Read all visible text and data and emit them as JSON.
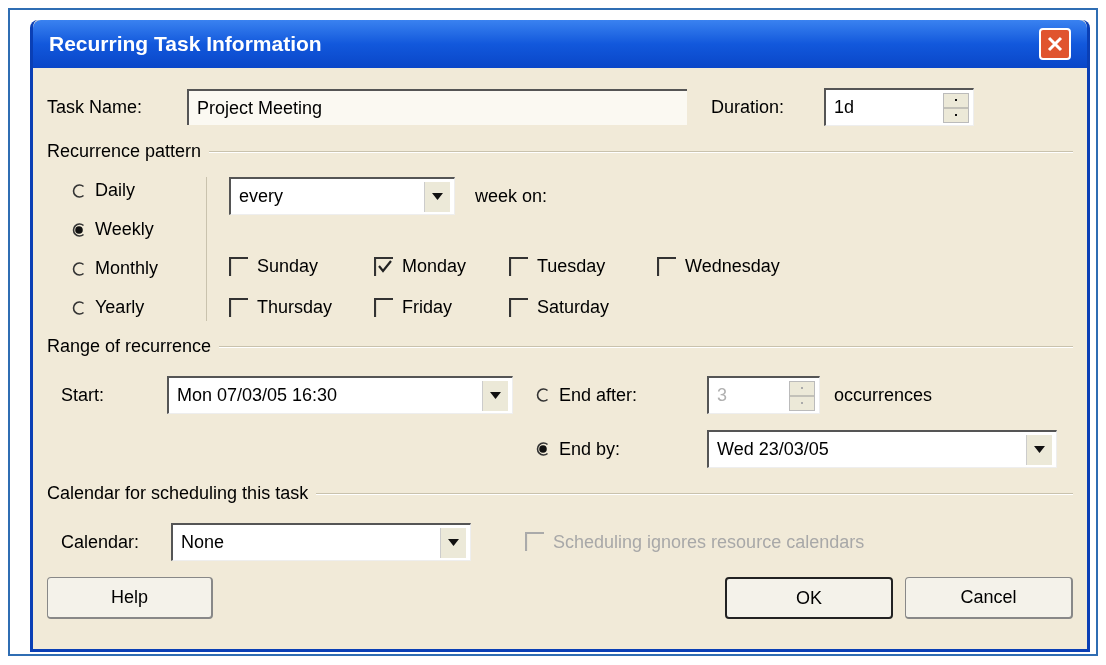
{
  "window": {
    "title": "Recurring Task Information"
  },
  "task_name": {
    "label": "Task Name:",
    "value": "Project Meeting"
  },
  "duration": {
    "label": "Duration:",
    "value": "1d"
  },
  "recurrence_pattern": {
    "title": "Recurrence pattern",
    "frequencies": [
      {
        "label": "Daily",
        "selected": false
      },
      {
        "label": "Weekly",
        "selected": true
      },
      {
        "label": "Monthly",
        "selected": false
      },
      {
        "label": "Yearly",
        "selected": false
      }
    ],
    "interval": {
      "value": "every"
    },
    "week_on_label": "week on:",
    "days": [
      {
        "label": "Sunday",
        "checked": false
      },
      {
        "label": "Monday",
        "checked": true
      },
      {
        "label": "Tuesday",
        "checked": false
      },
      {
        "label": "Wednesday",
        "checked": false
      },
      {
        "label": "Thursday",
        "checked": false
      },
      {
        "label": "Friday",
        "checked": false
      },
      {
        "label": "Saturday",
        "checked": false
      }
    ]
  },
  "range_of_recurrence": {
    "title": "Range of recurrence",
    "start": {
      "label": "Start:",
      "value": "Mon 07/03/05 16:30"
    },
    "end_after": {
      "label": "End after:",
      "selected": false,
      "value": "3",
      "disabled": true,
      "suffix": "occurrences"
    },
    "end_by": {
      "label": "End by:",
      "selected": true,
      "value": "Wed 23/03/05"
    }
  },
  "calendar_section": {
    "title": "Calendar for scheduling this task",
    "calendar": {
      "label": "Calendar:",
      "value": "None"
    },
    "ignore_resources": {
      "label": "Scheduling ignores resource calendars",
      "checked": false,
      "disabled": true
    }
  },
  "buttons": [
    {
      "label": "Help",
      "default": false
    },
    {
      "label": "OK",
      "default": true
    },
    {
      "label": "Cancel",
      "default": false
    }
  ]
}
